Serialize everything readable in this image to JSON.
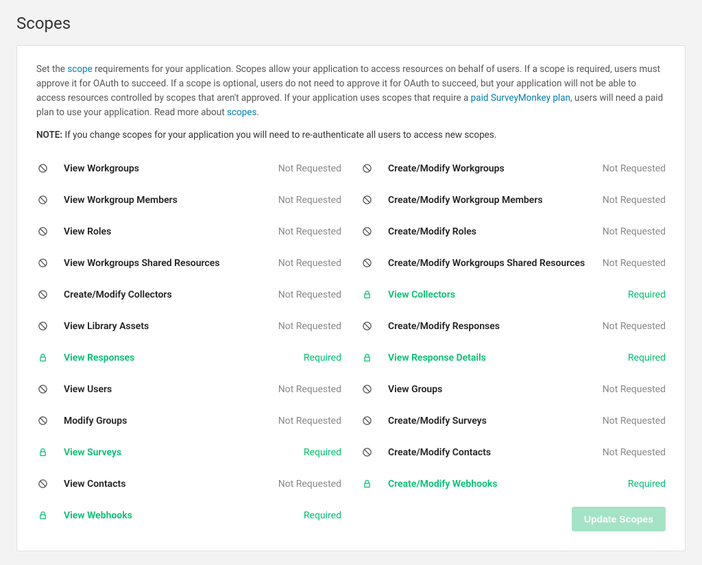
{
  "page": {
    "title": "Scopes"
  },
  "intro": {
    "t1": "Set the ",
    "link1": "scope",
    "t2": " requirements for your application. Scopes allow your application to access resources on behalf of users. If a scope is required, users must approve it for OAuth to succeed. If a scope is optional, users do not need to approve it for OAuth to succeed, but your application will not be able to access resources controlled by scopes that aren't approved. If your application uses scopes that require a ",
    "link2": "paid SurveyMonkey plan",
    "t3": ", users will need a paid plan to use your application. Read more about ",
    "link3": "scopes",
    "t4": "."
  },
  "note": {
    "prefix": "NOTE: ",
    "text": "If you change scopes for your application you will need to re-authenticate all users to access new scopes."
  },
  "statuses": {
    "not_requested": "Not Requested",
    "required": "Required"
  },
  "left": [
    {
      "label": "View Workgroups",
      "required": false
    },
    {
      "label": "View Workgroup Members",
      "required": false
    },
    {
      "label": "View Roles",
      "required": false
    },
    {
      "label": "View Workgroups Shared Resources",
      "required": false
    },
    {
      "label": "Create/Modify Collectors",
      "required": false
    },
    {
      "label": "View Library Assets",
      "required": false
    },
    {
      "label": "View Responses",
      "required": true
    },
    {
      "label": "View Users",
      "required": false
    },
    {
      "label": "Modify Groups",
      "required": false
    },
    {
      "label": "View Surveys",
      "required": true
    },
    {
      "label": "View Contacts",
      "required": false
    },
    {
      "label": "View Webhooks",
      "required": true
    }
  ],
  "right": [
    {
      "label": "Create/Modify Workgroups",
      "required": false
    },
    {
      "label": "Create/Modify Workgroup Members",
      "required": false
    },
    {
      "label": "Create/Modify Roles",
      "required": false
    },
    {
      "label": "Create/Modify Workgroups Shared Resources",
      "required": false
    },
    {
      "label": "View Collectors",
      "required": true
    },
    {
      "label": "Create/Modify Responses",
      "required": false
    },
    {
      "label": "View Response Details",
      "required": true
    },
    {
      "label": "View Groups",
      "required": false
    },
    {
      "label": "Create/Modify Surveys",
      "required": false
    },
    {
      "label": "Create/Modify Contacts",
      "required": false
    },
    {
      "label": "Create/Modify Webhooks",
      "required": true
    }
  ],
  "buttons": {
    "update": "Update Scopes"
  }
}
